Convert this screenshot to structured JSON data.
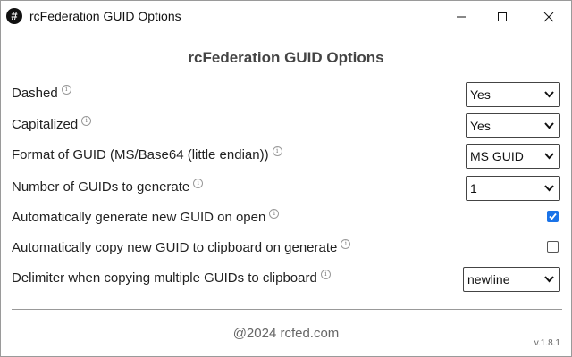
{
  "window": {
    "title": "rcFederation GUID Options",
    "icon": "#"
  },
  "heading": "rcFederation GUID Options",
  "info_glyph": "i",
  "options": [
    {
      "label": "Dashed",
      "control": "select",
      "value": "Yes"
    },
    {
      "label": "Capitalized",
      "control": "select",
      "value": "Yes"
    },
    {
      "label": "Format of GUID (MS/Base64 (little endian))",
      "control": "select",
      "value": "MS GUID"
    },
    {
      "label": "Number of GUIDs to generate",
      "control": "select",
      "value": "1"
    },
    {
      "label": "Automatically generate new GUID on open",
      "control": "checkbox",
      "checked": true
    },
    {
      "label": "Automatically copy new GUID to clipboard on generate",
      "control": "checkbox",
      "checked": false
    },
    {
      "label": "Delimiter when copying multiple GUIDs to clipboard",
      "control": "select",
      "value": "newline"
    }
  ],
  "footer": "@2024 rcfed.com",
  "version": "v.1.8.1",
  "colors": {
    "checkbox_accent": "#1a73e8"
  }
}
